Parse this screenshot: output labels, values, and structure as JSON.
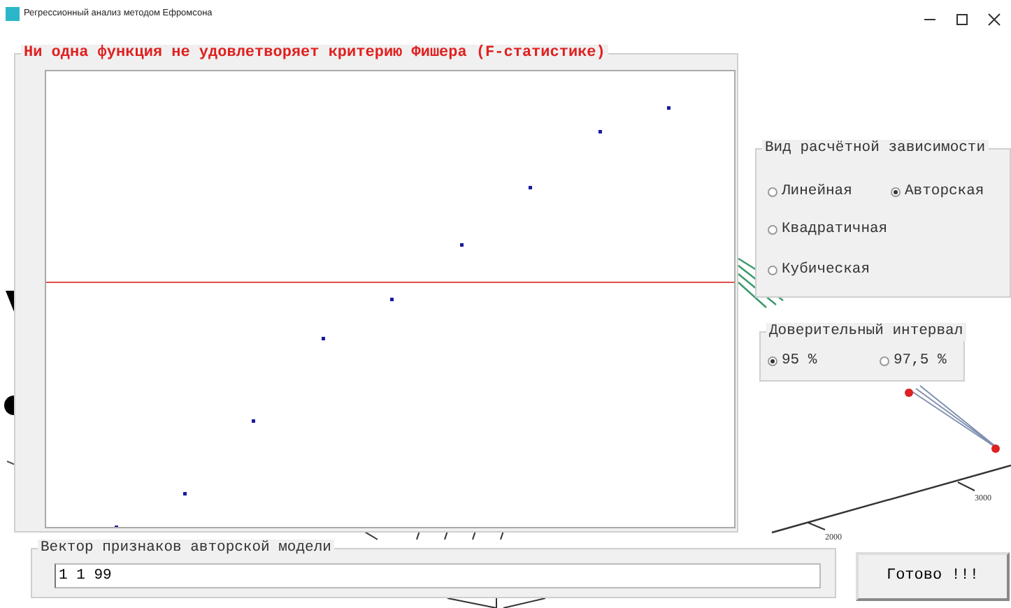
{
  "window": {
    "title": "Регрессионный анализ методом Ефромсона"
  },
  "plot_panel": {
    "title": "Ни одна функция не удовлетворяет критерию Фишера (F-статистике)"
  },
  "dependency_panel": {
    "title": "Вид расчётной зависимости",
    "options": [
      {
        "label": "Линейная",
        "selected": false
      },
      {
        "label": "Авторская",
        "selected": true
      },
      {
        "label": "Квадратичная",
        "selected": false
      },
      {
        "label": "Кубическая",
        "selected": false
      }
    ]
  },
  "interval_panel": {
    "title": "Доверительный интервал",
    "options": [
      {
        "label": "95 %",
        "selected": true
      },
      {
        "label": "97,5 %",
        "selected": false
      }
    ]
  },
  "vector_panel": {
    "title": "Вектор признаков авторской модели",
    "value": "1 1 99"
  },
  "done_button": {
    "label": "Готово !!!"
  },
  "background_axis": {
    "labels": [
      "2000",
      "3000"
    ]
  }
}
